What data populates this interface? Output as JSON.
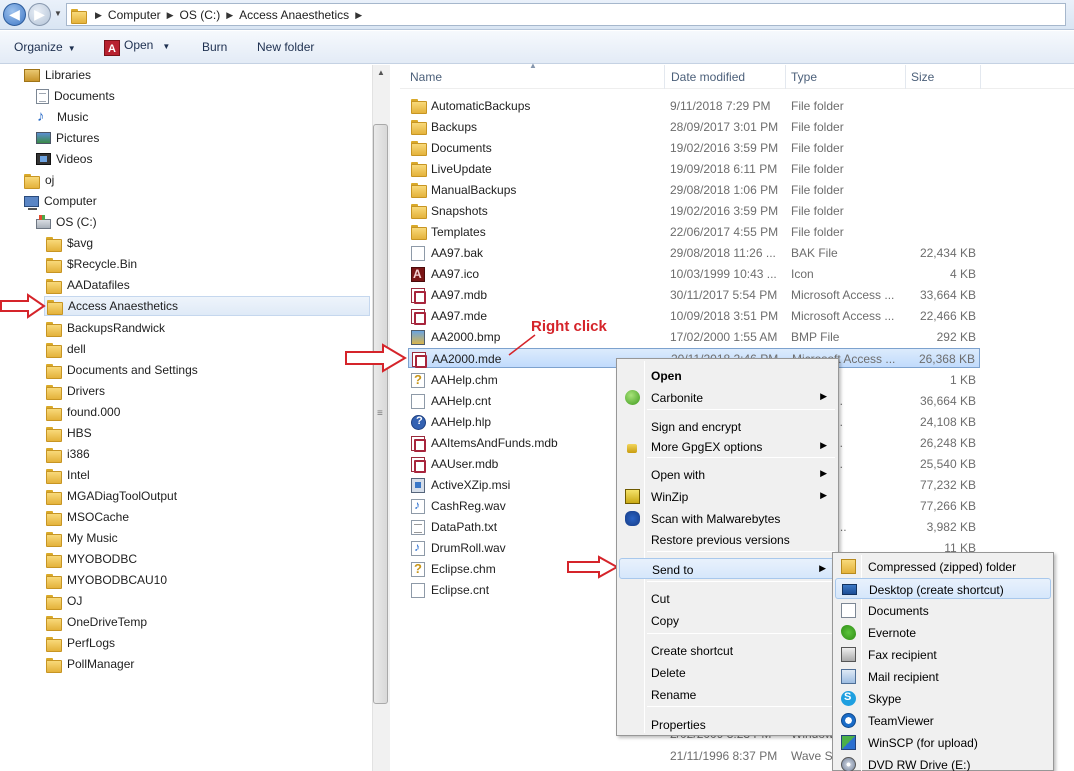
{
  "address_bar": {
    "crumbs": [
      "Computer",
      "OS (C:)",
      "Access Anaesthetics"
    ]
  },
  "toolbar": {
    "organize": "Organize",
    "open": "Open",
    "burn": "Burn",
    "new_folder": "New folder"
  },
  "nav": {
    "items": [
      {
        "label": "Libraries",
        "icon": "library-icon"
      },
      {
        "label": "Documents",
        "icon": "documents-icon"
      },
      {
        "label": "Music",
        "icon": "music-icon"
      },
      {
        "label": "Pictures",
        "icon": "pictures-icon"
      },
      {
        "label": "Videos",
        "icon": "videos-icon"
      },
      {
        "label": "oj",
        "icon": "user-folder-icon"
      },
      {
        "label": "Computer",
        "icon": "computer-icon"
      },
      {
        "label": "OS (C:)",
        "icon": "drive-icon"
      },
      {
        "label": "$avg",
        "icon": "folder-icon"
      },
      {
        "label": "$Recycle.Bin",
        "icon": "folder-icon"
      },
      {
        "label": "AADatafiles",
        "icon": "folder-icon"
      },
      {
        "label": "Access Anaesthetics",
        "icon": "folder-icon",
        "selected": true
      },
      {
        "label": "BackupsRandwick",
        "icon": "folder-icon"
      },
      {
        "label": "dell",
        "icon": "folder-icon"
      },
      {
        "label": "Documents and Settings",
        "icon": "folder-shortcut-icon"
      },
      {
        "label": "Drivers",
        "icon": "folder-icon"
      },
      {
        "label": "found.000",
        "icon": "folder-icon"
      },
      {
        "label": "HBS",
        "icon": "folder-icon"
      },
      {
        "label": "i386",
        "icon": "folder-icon"
      },
      {
        "label": "Intel",
        "icon": "folder-icon"
      },
      {
        "label": "MGADiagToolOutput",
        "icon": "folder-icon"
      },
      {
        "label": "MSOCache",
        "icon": "folder-icon"
      },
      {
        "label": "My Music",
        "icon": "folder-icon"
      },
      {
        "label": "MYOBODBC",
        "icon": "folder-icon"
      },
      {
        "label": "MYOBODBCAU10",
        "icon": "folder-icon"
      },
      {
        "label": "OJ",
        "icon": "folder-icon"
      },
      {
        "label": "OneDriveTemp",
        "icon": "folder-icon"
      },
      {
        "label": "PerfLogs",
        "icon": "folder-icon"
      },
      {
        "label": "PollManager",
        "icon": "folder-icon"
      }
    ]
  },
  "columns": {
    "name": "Name",
    "date": "Date modified",
    "type": "Type",
    "size": "Size"
  },
  "files": [
    {
      "name": "AutomaticBackups",
      "date": "9/11/2018 7:29 PM",
      "type": "File folder",
      "size": "",
      "icon": "folder"
    },
    {
      "name": "Backups",
      "date": "28/09/2017 3:01 PM",
      "type": "File folder",
      "size": "",
      "icon": "folder"
    },
    {
      "name": "Documents",
      "date": "19/02/2016 3:59 PM",
      "type": "File folder",
      "size": "",
      "icon": "folder"
    },
    {
      "name": "LiveUpdate",
      "date": "19/09/2018 6:11 PM",
      "type": "File folder",
      "size": "",
      "icon": "folder"
    },
    {
      "name": "ManualBackups",
      "date": "29/08/2018 1:06 PM",
      "type": "File folder",
      "size": "",
      "icon": "folder"
    },
    {
      "name": "Snapshots",
      "date": "19/02/2016 3:59 PM",
      "type": "File folder",
      "size": "",
      "icon": "folder"
    },
    {
      "name": "Templates",
      "date": "22/06/2017 4:55 PM",
      "type": "File folder",
      "size": "",
      "icon": "folder"
    },
    {
      "name": "AA97.bak",
      "date": "29/08/2018 11:26 ...",
      "type": "BAK File",
      "size": "22,434 KB",
      "icon": "file"
    },
    {
      "name": "AA97.ico",
      "date": "10/03/1999 10:43 ...",
      "type": "Icon",
      "size": "4 KB",
      "icon": "ico"
    },
    {
      "name": "AA97.mdb",
      "date": "30/11/2017 5:54 PM",
      "type": "Microsoft Access ...",
      "size": "33,664 KB",
      "icon": "mdb"
    },
    {
      "name": "AA97.mde",
      "date": "10/09/2018 3:51 PM",
      "type": "Microsoft Access ...",
      "size": "22,466 KB",
      "icon": "mdb"
    },
    {
      "name": "AA2000.bmp",
      "date": "17/02/2000 1:55 AM",
      "type": "BMP File",
      "size": "292 KB",
      "icon": "bmp"
    },
    {
      "name": "AA2000.mde",
      "date": "20/11/2018 2:46 PM",
      "type": "Microsoft Access ...",
      "size": "26,368 KB",
      "icon": "mdb",
      "selected": true
    },
    {
      "name": "AAHelp.chm",
      "date": "",
      "type": "",
      "size": "1 KB",
      "icon": "chm"
    },
    {
      "name": "AAHelp.cnt",
      "date": "",
      "type": "Access ...",
      "size": "36,664 KB",
      "icon": "file"
    },
    {
      "name": "AAHelp.hlp",
      "date": "",
      "type": "Access ...",
      "size": "24,108 KB",
      "icon": "hlp"
    },
    {
      "name": "AAItemsAndFunds.mdb",
      "date": "",
      "type": "Access ...",
      "size": "26,248 KB",
      "icon": "mdb"
    },
    {
      "name": "AAUser.mdb",
      "date": "",
      "type": "Access ...",
      "size": "25,540 KB",
      "icon": "mdb"
    },
    {
      "name": "ActiveXZip.msi",
      "date": "",
      "type": "",
      "size": "77,232 KB",
      "icon": "msi"
    },
    {
      "name": "CashReg.wav",
      "date": "",
      "type": "",
      "size": "77,266 KB",
      "icon": "wav"
    },
    {
      "name": "DataPath.txt",
      "date": "",
      "type": "d HTML ...",
      "size": "3,982 KB",
      "icon": "txt"
    },
    {
      "name": "DrumRoll.wav",
      "date": "",
      "type": "",
      "size": "11 KB",
      "icon": "wav"
    },
    {
      "name": "Eclipse.chm",
      "date": "",
      "type": "",
      "size": "",
      "icon": "chm"
    },
    {
      "name": "Eclipse.cnt",
      "date": "",
      "type": "",
      "size": "",
      "icon": "file"
    }
  ],
  "hidden_rows": [
    {
      "date": "2/02/2009 3:23 PM",
      "type": "Window"
    },
    {
      "date": "21/11/1996 8:37 PM",
      "type": "Wave So"
    }
  ],
  "annotation": {
    "right_click": "Right click",
    "arrow_color": "#d5242a"
  },
  "context_menu": {
    "items": [
      {
        "label": "Open",
        "bold": true
      },
      {
        "label": "Carbonite",
        "submenu": true,
        "icon": "carbonite-icon"
      },
      {
        "label": "Sign and encrypt"
      },
      {
        "label": "More GpgEX options",
        "submenu": true,
        "icon": "lock-icon"
      },
      {
        "label": "Open with",
        "submenu": true
      },
      {
        "label": "WinZip",
        "submenu": true,
        "icon": "winzip-icon"
      },
      {
        "label": "Scan with Malwarebytes",
        "icon": "malwarebytes-icon"
      },
      {
        "label": "Restore previous versions"
      },
      {
        "label": "Send to",
        "submenu": true,
        "highlighted": true
      },
      {
        "label": "Cut"
      },
      {
        "label": "Copy"
      },
      {
        "label": "Create shortcut"
      },
      {
        "label": "Delete"
      },
      {
        "label": "Rename"
      },
      {
        "label": "Properties"
      }
    ]
  },
  "send_to_menu": {
    "items": [
      {
        "label": "Compressed (zipped) folder",
        "icon": "zip-folder-icon"
      },
      {
        "label": "Desktop (create shortcut)",
        "icon": "desktop-icon",
        "highlighted": true
      },
      {
        "label": "Documents",
        "icon": "documents-icon"
      },
      {
        "label": "Evernote",
        "icon": "evernote-icon"
      },
      {
        "label": "Fax recipient",
        "icon": "fax-icon"
      },
      {
        "label": "Mail recipient",
        "icon": "mail-icon"
      },
      {
        "label": "Skype",
        "icon": "skype-icon"
      },
      {
        "label": "TeamViewer",
        "icon": "teamviewer-icon"
      },
      {
        "label": "WinSCP (for upload)",
        "icon": "winscp-icon"
      },
      {
        "label": "DVD RW Drive (E:)",
        "icon": "dvd-drive-icon"
      }
    ]
  }
}
